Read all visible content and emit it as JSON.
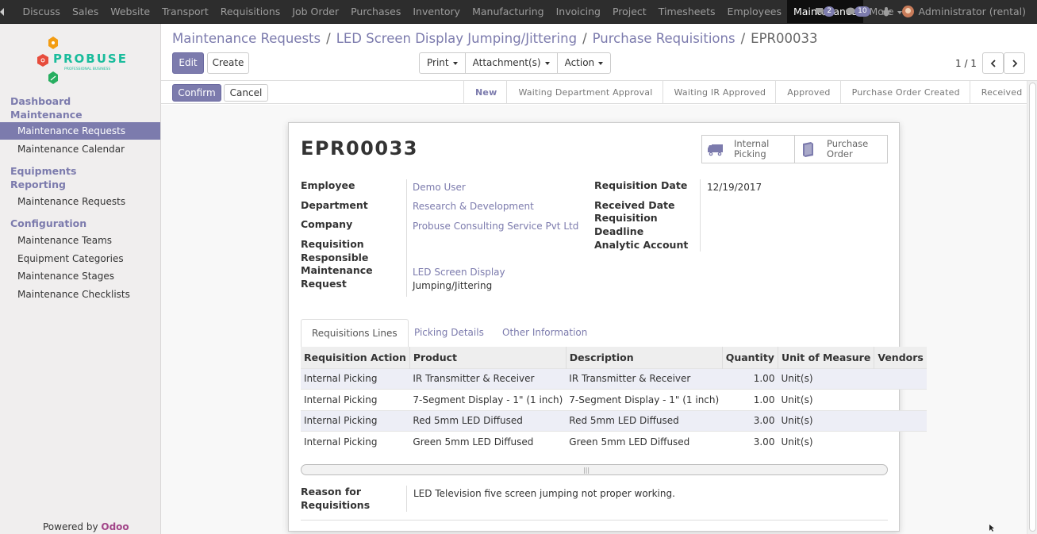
{
  "topbar": {
    "menu": [
      "Discuss",
      "Sales",
      "Website",
      "Transport",
      "Requisitions",
      "Job Order",
      "Purchases",
      "Inventory",
      "Manufacturing",
      "Invoicing",
      "Project",
      "Timesheets",
      "Employees",
      "Maintenance",
      "More"
    ],
    "active": "Maintenance",
    "chat_count": "2",
    "activity_count": "10",
    "user": "Administrator (rental)"
  },
  "sidebar": {
    "logo_text": "PROBUSE",
    "logo_sub": "PROFESSIONAL BUSINESS",
    "sections": {
      "dashboard": "Dashboard",
      "maintenance": "Maintenance",
      "equipments": "Equipments",
      "reporting": "Reporting",
      "configuration": "Configuration"
    },
    "items": {
      "maint_requests": "Maintenance Requests",
      "maint_calendar": "Maintenance Calendar",
      "report_requests": "Maintenance Requests",
      "teams": "Maintenance Teams",
      "categories": "Equipment Categories",
      "stages": "Maintenance Stages",
      "checklists": "Maintenance Checklists"
    },
    "powered": "Powered by",
    "powered_brand": "Odoo"
  },
  "breadcrumb": [
    "Maintenance Requests",
    "LED Screen Display Jumping/Jittering",
    "Purchase Requisitions",
    "EPR00033"
  ],
  "buttons": {
    "edit": "Edit",
    "create": "Create",
    "print": "Print",
    "attachments": "Attachment(s)",
    "action": "Action",
    "confirm": "Confirm",
    "cancel": "Cancel"
  },
  "pager": "1 / 1",
  "stages": [
    "New",
    "Waiting Department Approval",
    "Waiting IR Approved",
    "Approved",
    "Purchase Order Created",
    "Received"
  ],
  "current_stage": "New",
  "record": {
    "title": "EPR00033",
    "smart_buttons": [
      {
        "line1": "Internal",
        "line2": "Picking",
        "icon": "truck-icon"
      },
      {
        "line1": "Purchase",
        "line2": "Order",
        "icon": "book-icon"
      }
    ],
    "labels": {
      "employee": "Employee",
      "department": "Department",
      "company": "Company",
      "resp1": "Requisition",
      "resp2": "Responsible",
      "req1": "Maintenance",
      "req2": "Request",
      "req_date": "Requisition Date",
      "received_date": "Received Date",
      "deadline1": "Requisition",
      "deadline2": "Deadline",
      "analytic": "Analytic Account",
      "reason1": "Reason for",
      "reason2": "Requisitions"
    },
    "values": {
      "employee": "Demo User",
      "department": "Research & Development",
      "company": "Probuse Consulting Service Pvt Ltd",
      "maint_req1": "LED Screen Display",
      "maint_req2": "Jumping/Jittering",
      "req_date": "12/19/2017",
      "reason": "LED Television five screen jumping not proper working."
    }
  },
  "tabs": [
    "Requisitions Lines",
    "Picking Details",
    "Other Information"
  ],
  "table": {
    "headers": [
      "Requisition Action",
      "Product",
      "Description",
      "Quantity",
      "Unit of Measure",
      "Vendors"
    ],
    "rows": [
      [
        "Internal Picking",
        "IR Transmitter & Receiver",
        "IR Transmitter & Receiver",
        "1.00",
        "Unit(s)",
        ""
      ],
      [
        "Internal Picking",
        "7-Segment Display - 1\" (1 inch)",
        "7-Segment Display - 1\" (1 inch)",
        "1.00",
        "Unit(s)",
        ""
      ],
      [
        "Internal Picking",
        "Red 5mm LED Diffused",
        "Red 5mm LED Diffused",
        "3.00",
        "Unit(s)",
        ""
      ],
      [
        "Internal Picking",
        "Green 5mm LED Diffused",
        "Green 5mm LED Diffused",
        "3.00",
        "Unit(s)",
        ""
      ]
    ]
  }
}
